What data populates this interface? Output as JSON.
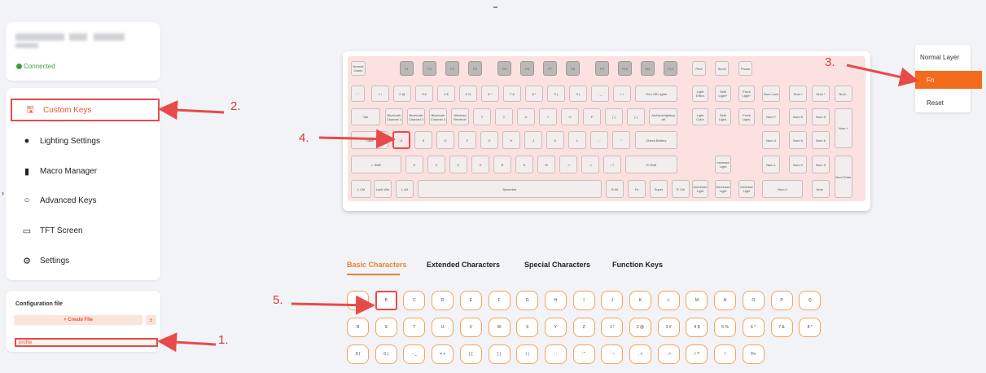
{
  "device": {
    "status": "Connected"
  },
  "nav": {
    "items": [
      {
        "label": "Custom Keys",
        "icon": "save-icon",
        "glyph": "🖫"
      },
      {
        "label": "Lighting Settings",
        "icon": "bulb-icon",
        "glyph": "●"
      },
      {
        "label": "Macro Manager",
        "icon": "macro-icon",
        "glyph": "▮"
      },
      {
        "label": "Advanced Keys",
        "icon": "advanced-icon",
        "glyph": "○"
      },
      {
        "label": "TFT Screen",
        "icon": "monitor-icon",
        "glyph": "▭"
      },
      {
        "label": "Settings",
        "icon": "gear-icon",
        "glyph": "⚙"
      }
    ]
  },
  "config": {
    "title": "Configuration file",
    "create_label": "+ Create File",
    "import_glyph": "±",
    "profile_name": "profile"
  },
  "layers": {
    "items": [
      "Normal Layer",
      "Fn",
      "Reset"
    ],
    "selected": "Fn"
  },
  "tabs": {
    "items": [
      "Basic Characters",
      "Extended Characters",
      "Special Characters",
      "Function Keys"
    ],
    "active": "Basic Characters"
  },
  "keyboard_keys": [
    "Normal Game",
    "F1",
    "F2",
    "F3",
    "F4",
    "F5",
    "F6",
    "F7",
    "F8",
    "F9",
    "F10",
    "F11",
    "F12",
    "Print",
    "Scroll",
    "Pause",
    "~ `",
    "1 !",
    "2 @",
    "3 #",
    "4 $",
    "5 %",
    "6 ^",
    "7 &",
    "8 *",
    "9 (",
    "0 )",
    "- _",
    "= +",
    "Turn Off Lights",
    "Light Effect",
    "Side Light+",
    "Front Light+",
    "Num Lock",
    "Num /",
    "Num *",
    "Num -",
    "Tab",
    "Bluetooth Channel 1",
    "Bluetooth Channel 2",
    "Bluetooth Channel 3",
    "Wireless Receiver",
    "T",
    "Y",
    "U",
    "I",
    "O",
    "P",
    "[ {",
    "] }",
    "Ambient lighting off",
    "Light Color",
    "Side Light-",
    "Front Light-",
    "Num 7",
    "Num 8",
    "Num 9",
    "Num +",
    "Caps",
    "A",
    "S",
    "D",
    "F",
    "G",
    "H",
    "J",
    "K",
    "L",
    "; :",
    "' \"",
    "Check Battery",
    "Num 4",
    "Num 5",
    "Num 6",
    "L Shift",
    "Z",
    "X",
    "C",
    "V",
    "B",
    "N",
    "M",
    ", <",
    ". >",
    "/ ?",
    "R Shift",
    "Increase Light",
    "Num 1",
    "Num 2",
    "Num 3",
    "Num Enter",
    "L Ctrl",
    "Lock Win",
    "L Alt",
    "Spacebar",
    "R Alt",
    "Fn",
    "Super",
    "R Ctrl",
    "Decrease Light",
    "Decrease Light",
    "Increase Light",
    "Num 0",
    "Num ."
  ],
  "char_keys": [
    "A",
    "B",
    "C",
    "D",
    "E",
    "F",
    "G",
    "H",
    "I",
    "J",
    "K",
    "L",
    "M",
    "N",
    "O",
    "P",
    "Q",
    "R",
    "S",
    "T",
    "U",
    "V",
    "W",
    "X",
    "Y",
    "Z",
    "1 !",
    "2 @",
    "3 #",
    "4 $",
    "5 %",
    "6 ^",
    "7 &",
    "8 *",
    "9 (",
    "0 )",
    "- _",
    "= +",
    "[ {",
    "] }",
    "\\ |",
    "; :",
    "' \"",
    "` ~",
    ", <",
    ". >",
    "/ ?",
    "\\",
    "Fn"
  ],
  "annotations": [
    "1.",
    "2.",
    "3.",
    "4.",
    "5."
  ],
  "colors": {
    "accent": "#f56b1d",
    "annotation": "#e84a4a",
    "connected": "#3aa043"
  }
}
